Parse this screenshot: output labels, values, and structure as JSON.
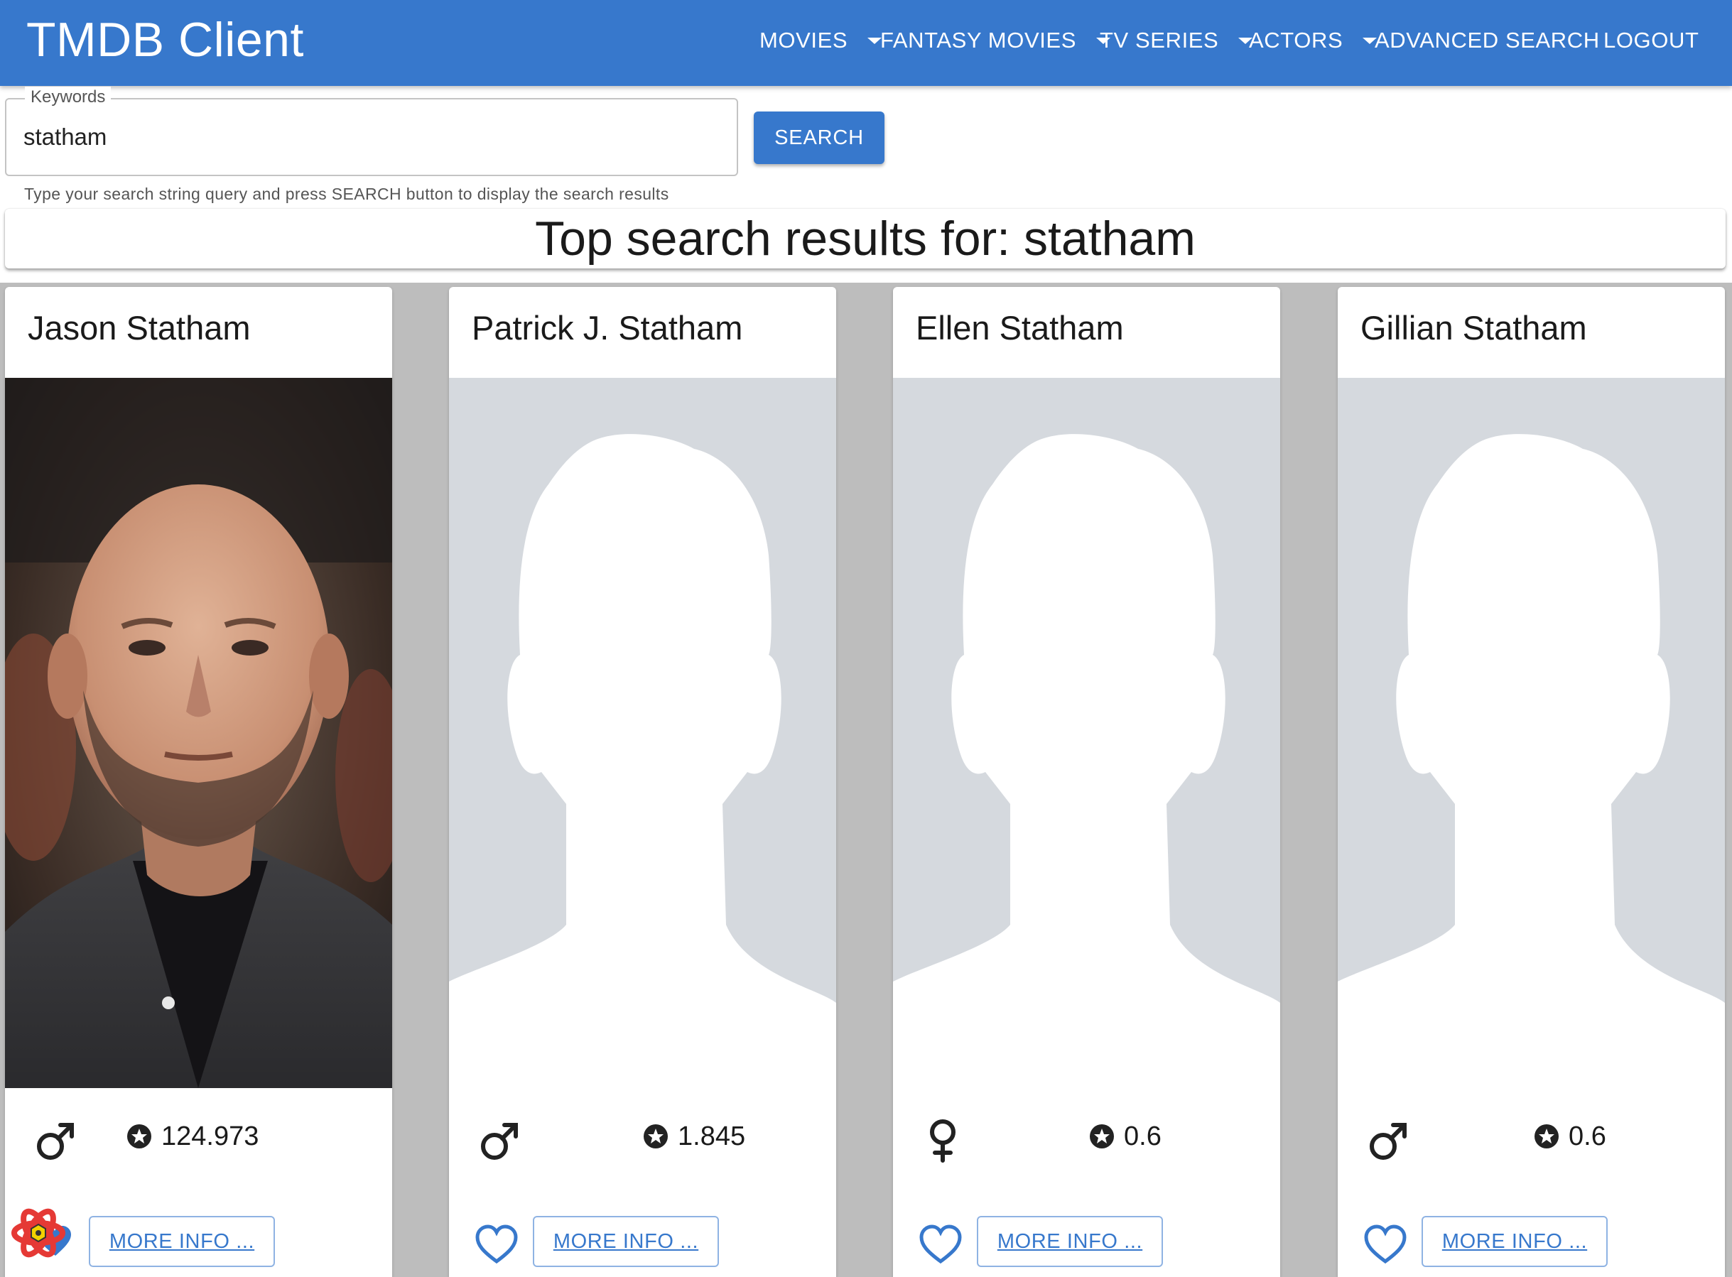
{
  "app": {
    "title": "TMDB Client"
  },
  "nav": {
    "movies": "MOVIES",
    "fantasy_movies": "FANTASY MOVIES",
    "tv_series": "TV SERIES",
    "actors": "ACTORS",
    "advanced_search": "ADVANCED SEARCH",
    "logout": "LOGOUT"
  },
  "search": {
    "label": "Keywords",
    "value": "statham",
    "helper": "Type your search string query and press SEARCH button to display the search results",
    "button": "SEARCH"
  },
  "results": {
    "heading": "Top search results for: statham",
    "cards": [
      {
        "name": "Jason Statham",
        "gender": "male",
        "popularity": "124.973",
        "has_photo": true,
        "more_info": "MORE INFO ..."
      },
      {
        "name": "Patrick J. Statham",
        "gender": "male",
        "popularity": "1.845",
        "has_photo": false,
        "more_info": "MORE INFO ..."
      },
      {
        "name": "Ellen Statham",
        "gender": "female",
        "popularity": "0.6",
        "has_photo": false,
        "more_info": "MORE INFO ..."
      },
      {
        "name": "Gillian Statham",
        "gender": "male",
        "popularity": "0.6",
        "has_photo": false,
        "more_info": "MORE INFO ..."
      }
    ]
  },
  "icons": {
    "male": "male-symbol-icon",
    "female": "female-symbol-icon",
    "popularity": "star-badge-icon",
    "favorite": "heart-outline-icon",
    "placeholder": "person-silhouette-icon"
  },
  "colors": {
    "primary": "#3778cc",
    "grid_background": "#bdbdbd",
    "placeholder_background": "#d5d9de"
  }
}
